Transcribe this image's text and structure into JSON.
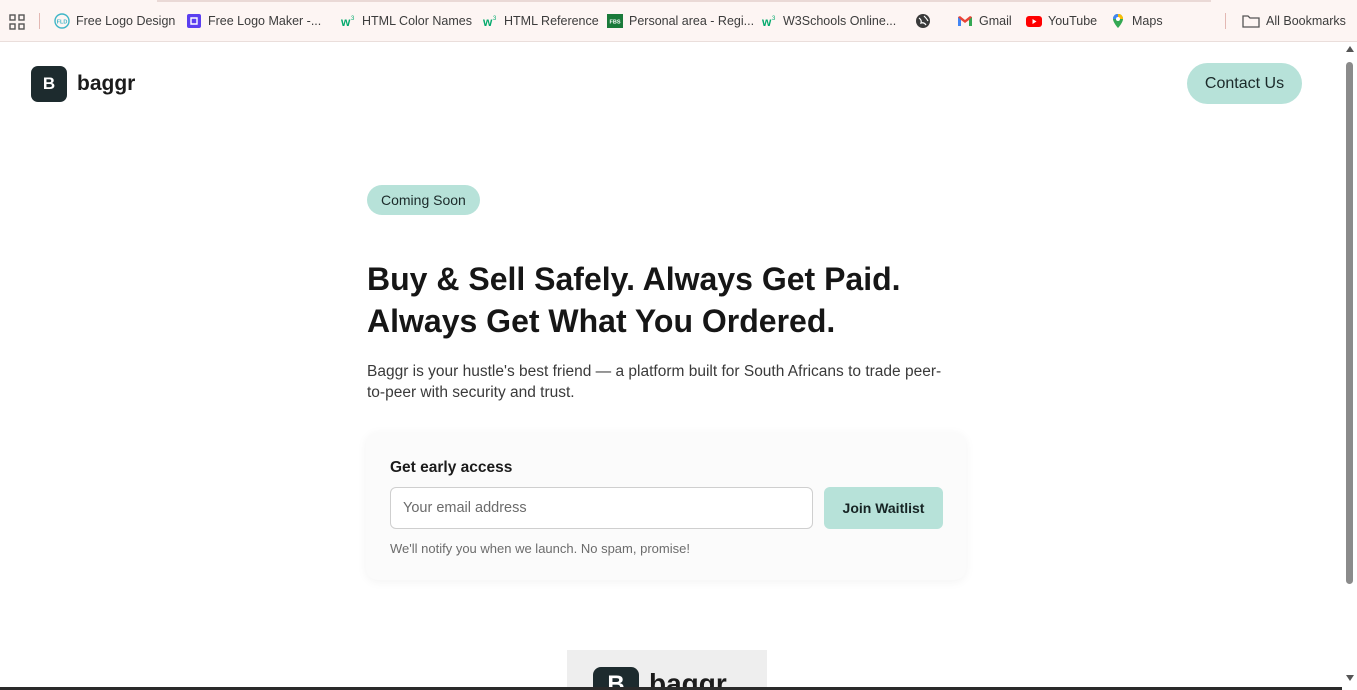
{
  "bookmarks": {
    "items": [
      {
        "label": "Free Logo Design",
        "icon": "fld-icon"
      },
      {
        "label": "Free Logo Maker -...",
        "icon": "logo-maker-icon"
      },
      {
        "label": "HTML Color Names",
        "icon": "w3schools-icon"
      },
      {
        "label": "HTML Reference",
        "icon": "w3schools-icon"
      },
      {
        "label": "Personal area - Regi...",
        "icon": "fbs-icon"
      },
      {
        "label": "W3Schools Online...",
        "icon": "w3schools-icon"
      },
      {
        "label": "",
        "icon": "globe-icon"
      },
      {
        "label": "Gmail",
        "icon": "gmail-icon"
      },
      {
        "label": "YouTube",
        "icon": "youtube-icon"
      },
      {
        "label": "Maps",
        "icon": "maps-icon"
      }
    ],
    "all_bookmarks": "All Bookmarks"
  },
  "header": {
    "logo_letter": "B",
    "brand": "baggr",
    "contact_label": "Contact Us"
  },
  "hero": {
    "badge": "Coming Soon",
    "headline_line1": "Buy & Sell Safely. Always Get Paid.",
    "headline_line2": "Always Get What You Ordered.",
    "subtext_line1": "Baggr is your hustle's best friend — a platform built for South Africans to trade peer-",
    "subtext_line2": "to-peer with security and trust."
  },
  "waitlist": {
    "title": "Get early access",
    "email_placeholder": "Your email address",
    "email_value": "",
    "button_label": "Join Waitlist",
    "note": "We'll notify you when we launch. No spam, promise!"
  },
  "peek": {
    "logo_letter": "B",
    "brand": "baggr"
  },
  "colors": {
    "accent": "#b7e2d9",
    "logo_bg": "#1d2b2e",
    "bookmark_bar_bg": "#fdf5f3"
  }
}
